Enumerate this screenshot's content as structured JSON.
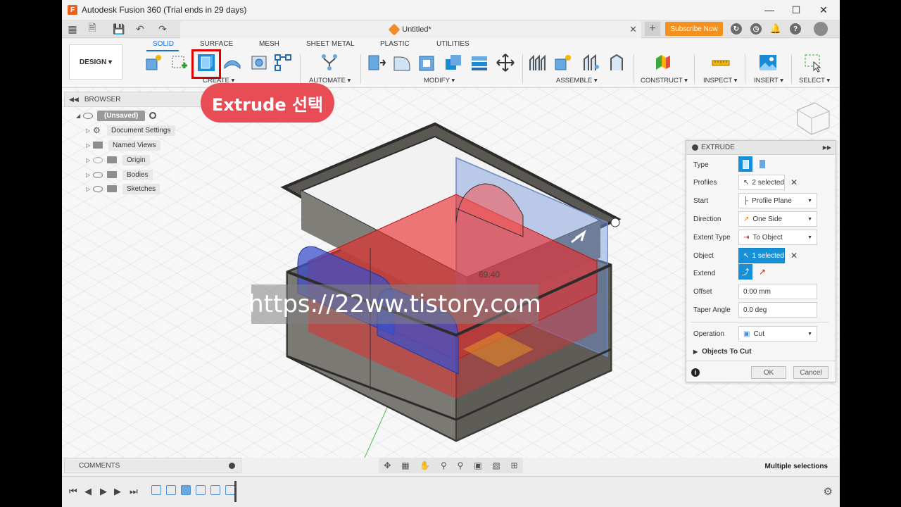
{
  "window": {
    "title": "Autodesk Fusion 360 (Trial ends in 29 days)",
    "logo_letter": "F"
  },
  "tabbar": {
    "doc_title": "Untitled*",
    "subscribe_label": "Subscribe Now"
  },
  "toolbar": {
    "design_label": "DESIGN ▾",
    "workspace_tabs": [
      "SOLID",
      "SURFACE",
      "MESH",
      "SHEET METAL",
      "PLASTIC",
      "UTILITIES"
    ],
    "groups": [
      "CREATE ▾",
      "AUTOMATE ▾",
      "MODIFY ▾",
      "ASSEMBLE ▾",
      "CONSTRUCT ▾",
      "INSPECT ▾",
      "INSERT ▾",
      "SELECT ▾"
    ]
  },
  "browser": {
    "title": "BROWSER",
    "root": "(Unsaved)",
    "items": [
      "Document Settings",
      "Named Views",
      "Origin",
      "Bodies",
      "Sketches"
    ]
  },
  "callout": "Extrude 선택",
  "watermark": "https://22ww.tistory.com",
  "dimension_label": "69.40",
  "extrude_panel": {
    "title": "EXTRUDE",
    "type_label": "Type",
    "profiles_label": "Profiles",
    "profiles_value": "2 selected",
    "start_label": "Start",
    "start_value": "Profile Plane",
    "direction_label": "Direction",
    "direction_value": "One Side",
    "extent_label": "Extent Type",
    "extent_value": "To Object",
    "object_label": "Object",
    "object_value": "1 selected",
    "extend_label": "Extend",
    "offset_label": "Offset",
    "offset_value": "0.00 mm",
    "taper_label": "Taper Angle",
    "taper_value": "0.0 deg",
    "operation_label": "Operation",
    "operation_value": "Cut",
    "objects_to_cut": "Objects To Cut",
    "ok_label": "OK",
    "cancel_label": "Cancel"
  },
  "comments": {
    "title": "COMMENTS"
  },
  "status": {
    "text": "Multiple selections"
  },
  "colors": {
    "accent": "#1a6fd1",
    "callout": "#e84c55",
    "subscribe": "#f4901e",
    "highlight": "#e00000"
  }
}
